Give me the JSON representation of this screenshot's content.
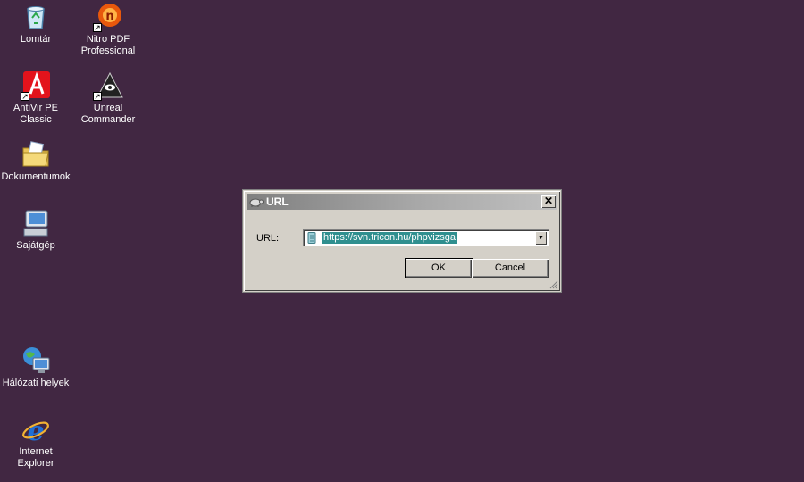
{
  "desktop": {
    "icons": [
      {
        "name": "recycle-bin-icon",
        "label_lines": [
          "Lomtár"
        ]
      },
      {
        "name": "nitro-pdf-icon",
        "label_lines": [
          "Nitro PDF",
          "Professional"
        ]
      },
      {
        "name": "antivir-icon",
        "label_lines": [
          "AntiVir PE",
          "Classic"
        ]
      },
      {
        "name": "unreal-commander-icon",
        "label_lines": [
          "Unreal",
          "Commander"
        ]
      },
      {
        "name": "documents-folder-icon",
        "label_lines": [
          "Dokumentumok"
        ]
      },
      {
        "name": "my-computer-icon",
        "label_lines": [
          "Sajátgép"
        ]
      },
      {
        "name": "network-places-icon",
        "label_lines": [
          "Hálózati helyek"
        ]
      },
      {
        "name": "internet-explorer-icon",
        "label_lines": [
          "Internet",
          "Explorer"
        ]
      }
    ]
  },
  "dialog": {
    "title": "URL",
    "close_glyph": "✕",
    "url_label": "URL:",
    "url_value": "https://svn.tricon.hu/phpvizsga",
    "ok_label": "OK",
    "cancel_label": "Cancel"
  }
}
